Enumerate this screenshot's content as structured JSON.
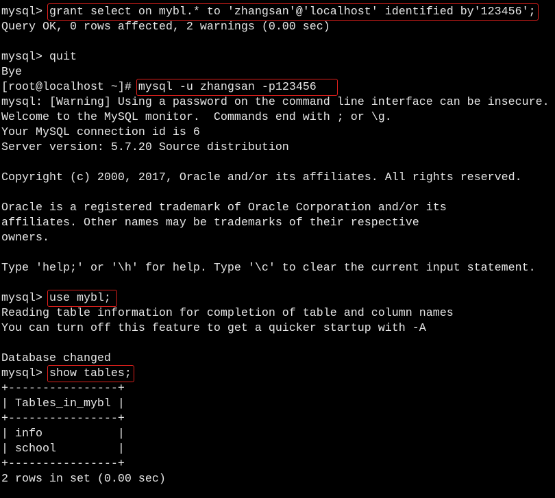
{
  "terminal": {
    "lines": [
      {
        "prompt": "mysql> ",
        "cmd": "grant select on mybl.* to 'zhangsan'@'localhost' identified by'123456';",
        "highlight": true
      },
      {
        "prompt": "",
        "cmd": "Query OK, 0 rows affected, 2 warnings (0.00 sec)",
        "highlight": false
      },
      {
        "prompt": "",
        "cmd": "",
        "highlight": false
      },
      {
        "prompt": "mysql> ",
        "cmd": "quit",
        "highlight": false
      },
      {
        "prompt": "",
        "cmd": "Bye",
        "highlight": false
      },
      {
        "prompt": "[root@localhost ~]# ",
        "cmd": "mysql -u zhangsan -p123456",
        "highlight": true
      },
      {
        "prompt": "",
        "cmd": "mysql: [Warning] Using a password on the command line interface can be insecure.",
        "highlight": false
      },
      {
        "prompt": "",
        "cmd": "Welcome to the MySQL monitor.  Commands end with ; or \\g.",
        "highlight": false
      },
      {
        "prompt": "",
        "cmd": "Your MySQL connection id is 6",
        "highlight": false
      },
      {
        "prompt": "",
        "cmd": "Server version: 5.7.20 Source distribution",
        "highlight": false
      },
      {
        "prompt": "",
        "cmd": "",
        "highlight": false
      },
      {
        "prompt": "",
        "cmd": "Copyright (c) 2000, 2017, Oracle and/or its affiliates. All rights reserved.",
        "highlight": false
      },
      {
        "prompt": "",
        "cmd": "",
        "highlight": false
      },
      {
        "prompt": "",
        "cmd": "Oracle is a registered trademark of Oracle Corporation and/or its",
        "highlight": false
      },
      {
        "prompt": "",
        "cmd": "affiliates. Other names may be trademarks of their respective",
        "highlight": false
      },
      {
        "prompt": "",
        "cmd": "owners.",
        "highlight": false
      },
      {
        "prompt": "",
        "cmd": "",
        "highlight": false
      },
      {
        "prompt": "",
        "cmd": "Type 'help;' or '\\h' for help. Type '\\c' to clear the current input statement.",
        "highlight": false
      },
      {
        "prompt": "",
        "cmd": "",
        "highlight": false
      },
      {
        "prompt": "mysql> ",
        "cmd": "use mybl;",
        "highlight": true
      },
      {
        "prompt": "",
        "cmd": "Reading table information for completion of table and column names",
        "highlight": false
      },
      {
        "prompt": "",
        "cmd": "You can turn off this feature to get a quicker startup with -A",
        "highlight": false
      },
      {
        "prompt": "",
        "cmd": "",
        "highlight": false
      },
      {
        "prompt": "",
        "cmd": "Database changed",
        "highlight": false
      },
      {
        "prompt": "mysql> ",
        "cmd": "show tables;",
        "highlight": true
      },
      {
        "prompt": "",
        "cmd": "+----------------+",
        "highlight": false
      },
      {
        "prompt": "",
        "cmd": "| Tables_in_mybl |",
        "highlight": false
      },
      {
        "prompt": "",
        "cmd": "+----------------+",
        "highlight": false
      },
      {
        "prompt": "",
        "cmd": "| info           |",
        "highlight": false
      },
      {
        "prompt": "",
        "cmd": "| school         |",
        "highlight": false
      },
      {
        "prompt": "",
        "cmd": "+----------------+",
        "highlight": false
      },
      {
        "prompt": "",
        "cmd": "2 rows in set (0.00 sec)",
        "highlight": false
      }
    ],
    "highlight_color": "#e0201c",
    "text_color": "#e6e6e6",
    "background": "#000000"
  }
}
